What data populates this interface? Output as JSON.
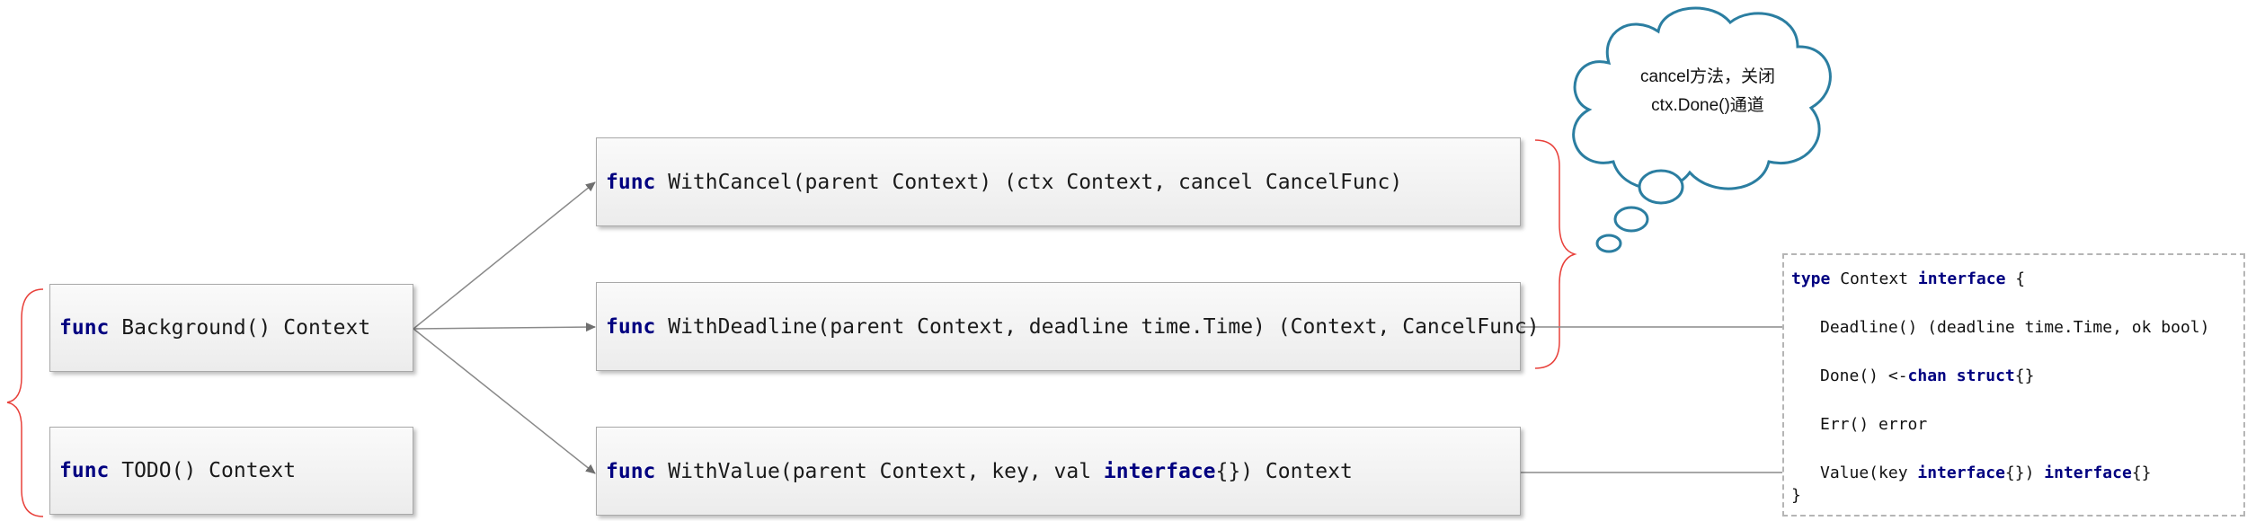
{
  "boxes": {
    "background": {
      "kw": "func",
      "rest": " Background() Context"
    },
    "todo": {
      "kw": "func",
      "rest": " TODO() Context"
    },
    "with_cancel": {
      "kw": "func",
      "rest": " WithCancel(parent Context) (ctx Context, cancel CancelFunc)"
    },
    "with_deadline": {
      "kw": "func",
      "rest": " WithDeadline(parent Context, deadline time.Time) (Context, CancelFunc)"
    },
    "with_value": {
      "kw": "func",
      "rest_a": " WithValue(parent Context, key, val ",
      "kw2": "interface",
      "rest_b": "{}) Context"
    }
  },
  "cloud": {
    "line1": "cancel方法，关闭",
    "line2": "ctx.Done()通道"
  },
  "interface_box": {
    "l1_kw": "type",
    "l1_mid": " Context ",
    "l1_kw2": "interface",
    "l1_end": " {",
    "l2": "Deadline() (deadline time.Time, ok bool)",
    "l3_pre": "Done() <-",
    "l3_kw": "chan",
    "l3_sp": " ",
    "l3_kw2": "struct",
    "l3_end": "{}",
    "l4": "Err() error",
    "l5_pre": "Value(key ",
    "l5_kw": "interface",
    "l5_mid": "{}) ",
    "l5_kw2": "interface",
    "l5_end": "{}",
    "l6": "}"
  },
  "colors": {
    "keyword": "#000080",
    "brace": "#e8403a",
    "cloud_stroke": "#2b7ea1",
    "arrow": "#777777"
  }
}
